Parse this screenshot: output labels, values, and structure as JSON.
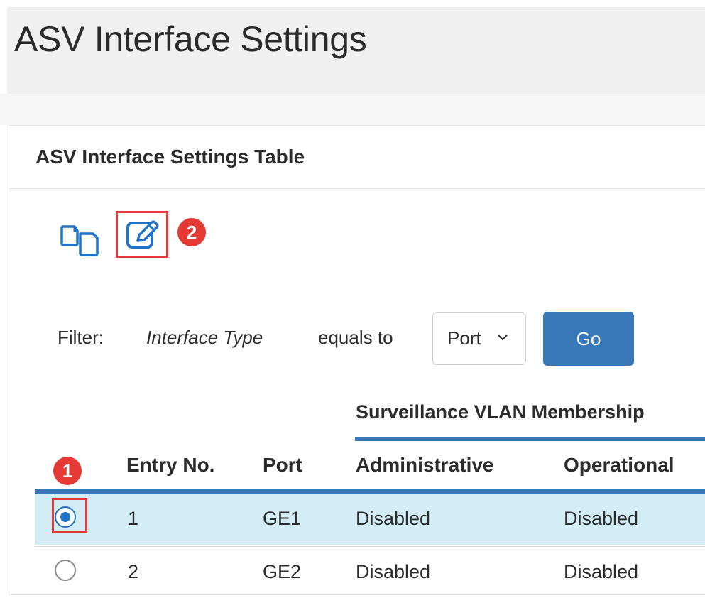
{
  "page": {
    "title": "ASV Interface Settings"
  },
  "card": {
    "title": "ASV Interface Settings Table"
  },
  "toolbar": {
    "copy_icon": "copy-settings-icon",
    "edit_icon": "edit-icon",
    "edit_step": "2"
  },
  "filter": {
    "label": "Filter:",
    "field": "Interface Type",
    "operator": "equals to",
    "selected_value": "Port",
    "go_label": "Go"
  },
  "table": {
    "group_header": "Surveillance VLAN Membership",
    "select_step": "1",
    "columns": {
      "entry": "Entry No.",
      "port": "Port",
      "administrative": "Administrative",
      "operational": "Operational"
    },
    "rows": [
      {
        "entry": "1",
        "port": "GE1",
        "administrative": "Disabled",
        "operational": "Disabled",
        "selected": true
      },
      {
        "entry": "2",
        "port": "GE2",
        "administrative": "Disabled",
        "operational": "Disabled",
        "selected": false
      }
    ]
  },
  "colors": {
    "accent": "#3978b8",
    "highlight": "#e53935",
    "selected_row": "#d3edf7"
  }
}
